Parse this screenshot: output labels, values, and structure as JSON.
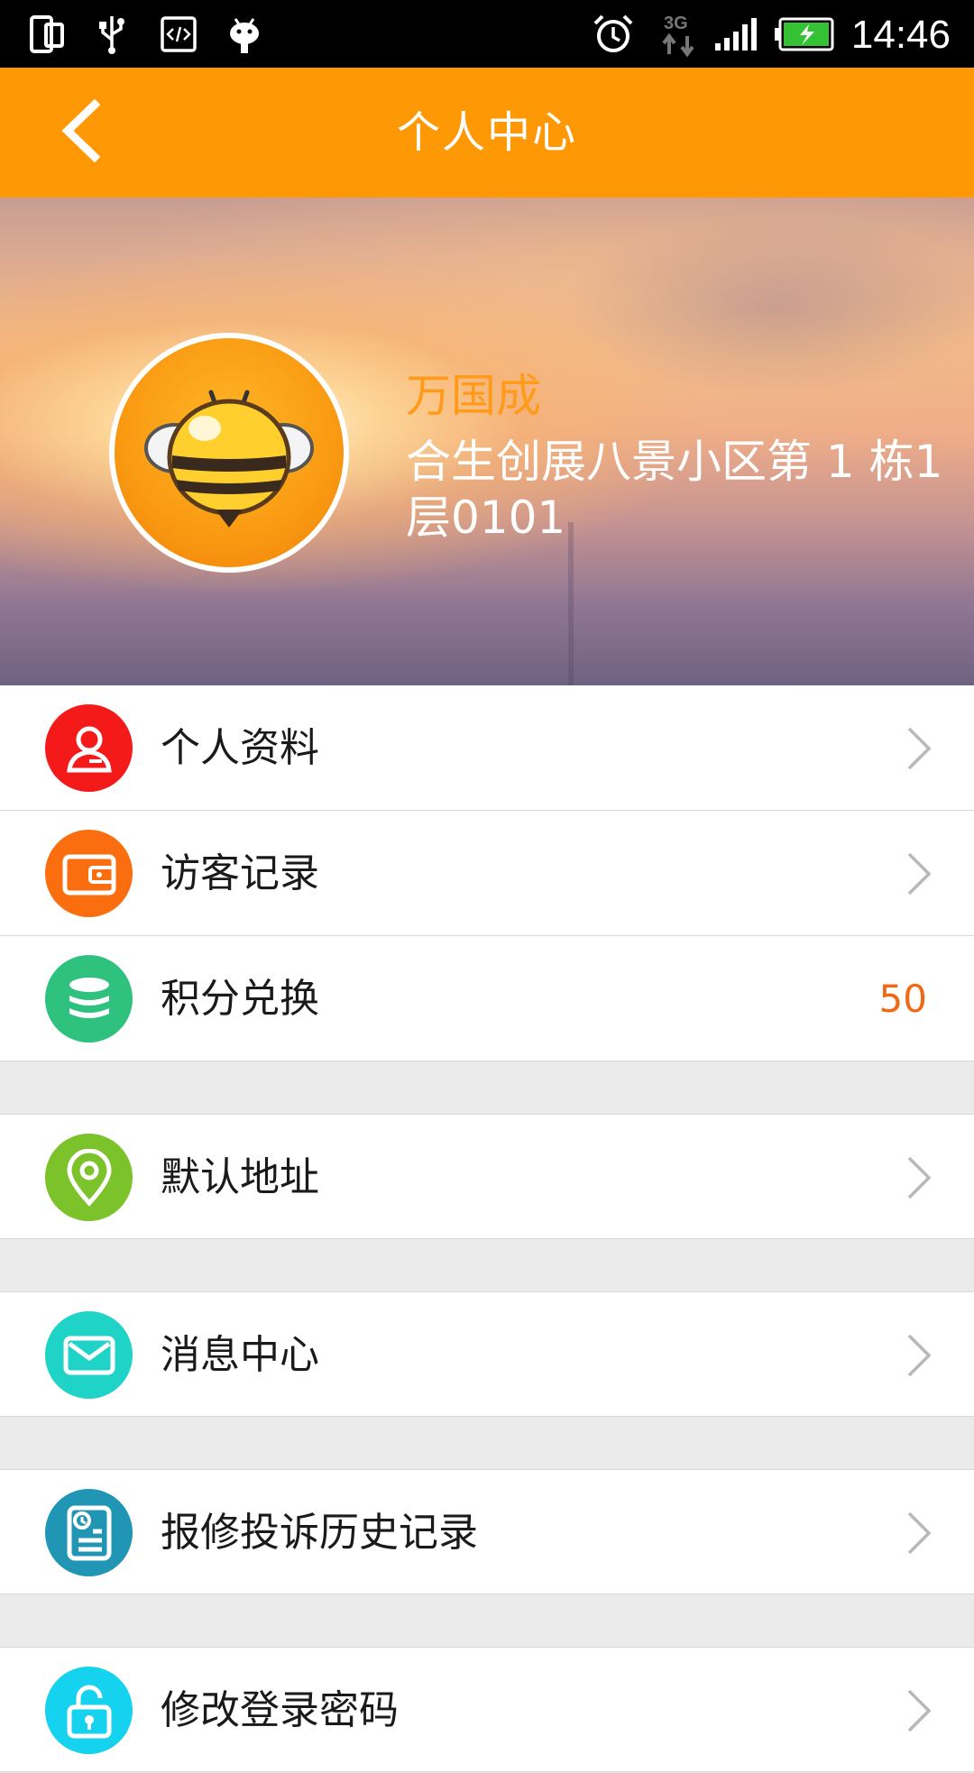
{
  "status_bar": {
    "time": "14:46",
    "icons": [
      "dual-screen-icon",
      "usb-icon",
      "code-icon",
      "android-icon",
      "alarm-icon",
      "3g-data-icon",
      "signal-icon",
      "battery-charging-icon"
    ]
  },
  "header": {
    "title": "个人中心",
    "back_icon": "chevron-left-icon",
    "color": "#ff9805"
  },
  "profile": {
    "name": "万国成",
    "address": "合生创展八景小区第 1 栋1层0101",
    "avatar_icon": "bee-avatar-icon"
  },
  "menu": [
    {
      "label": "个人资料",
      "icon": "user-profile-icon",
      "icon_color": "#f51a1a"
    },
    {
      "label": "访客记录",
      "icon": "wallet-icon",
      "icon_color": "#fb6e10"
    },
    {
      "label": "积分兑换",
      "icon": "coins-stack-icon",
      "icon_color": "#2ec27e",
      "value": "50"
    },
    {
      "label": "默认地址",
      "icon": "location-pin-icon",
      "icon_color": "#7cc22a"
    },
    {
      "label": "消息中心",
      "icon": "envelope-icon",
      "icon_color": "#1fd3c7"
    },
    {
      "label": "报修投诉历史记录",
      "icon": "document-clock-icon",
      "icon_color": "#2196b4"
    },
    {
      "label": "修改登录密码",
      "icon": "unlock-icon",
      "icon_color": "#15d2ee"
    }
  ]
}
